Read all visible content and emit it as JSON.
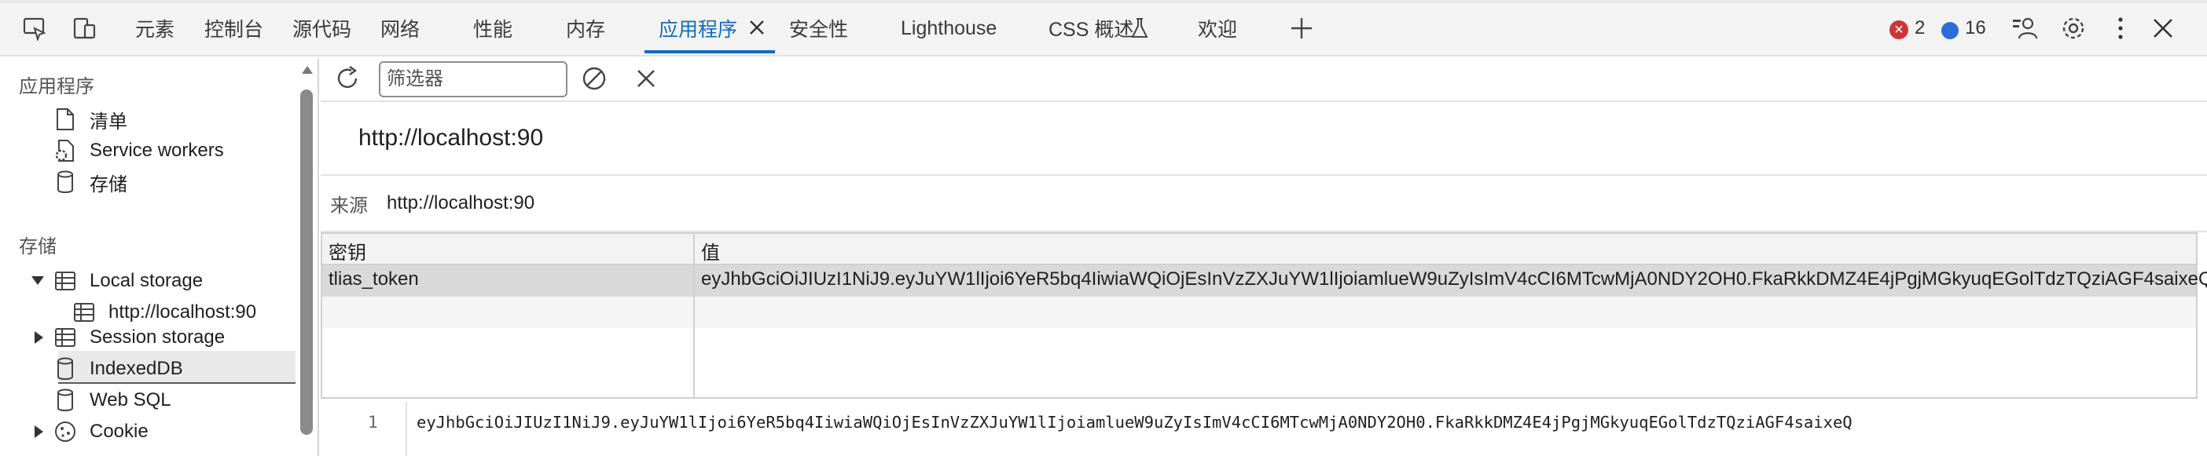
{
  "toolbar": {
    "tabs": [
      {
        "label": "元素"
      },
      {
        "label": "控制台"
      },
      {
        "label": "源代码"
      },
      {
        "label": "网络"
      },
      {
        "label": "性能"
      },
      {
        "label": "内存"
      },
      {
        "label": "应用程序"
      },
      {
        "label": "安全性"
      },
      {
        "label": "Lighthouse"
      },
      {
        "label": "CSS 概述"
      },
      {
        "label": "欢迎"
      }
    ],
    "active_tab": "应用程序",
    "error_count": "2",
    "message_count": "16",
    "accent_color": "#0f6cbd",
    "icons": [
      "inspect-icon",
      "device-toolbar-icon",
      "add-tab-icon",
      "profile-icon",
      "gear-icon",
      "more-icon",
      "close-icon"
    ]
  },
  "sidebar": {
    "section_app": "应用程序",
    "app_items": [
      {
        "label": "清单",
        "icon": "file-icon"
      },
      {
        "label": "Service workers",
        "icon": "service-worker-icon"
      },
      {
        "label": "存储",
        "icon": "database-icon"
      }
    ],
    "section_storage": "存储",
    "storage_items": [
      {
        "label": "Local storage",
        "icon": "table-icon",
        "expanded": true
      },
      {
        "label": "http://localhost:90",
        "icon": "table-icon",
        "selected": true
      },
      {
        "label": "Session storage",
        "icon": "table-icon",
        "expanded": false
      },
      {
        "label": "IndexedDB",
        "icon": "database-icon"
      },
      {
        "label": "Web SQL",
        "icon": "database-icon"
      },
      {
        "label": "Cookie",
        "icon": "cookie-icon",
        "expanded": false
      }
    ]
  },
  "main": {
    "filter_placeholder": "筛选器",
    "origin_title": "http://localhost:90",
    "origin_label": "来源",
    "origin_value": "http://localhost:90",
    "columns": {
      "key": "密钥",
      "value": "值"
    },
    "rows": [
      {
        "key": "tlias_token",
        "value": "eyJhbGciOiJIUzI1NiJ9.eyJuYW1lIjoi6YeR5bq4IiwiaWQiOjEsInVzZXJuYW1lIjoiamlueW9uZyIsImV4cCI6MTcwMjA0NDY2OH0.FkaRkkDMZ4E4jPgjMGkyuqEGolTdzTQziAGF4saixeQ"
      }
    ],
    "preview_line_number": "1",
    "preview_text": "eyJhbGciOiJIUzI1NiJ9.eyJuYW1lIjoi6YeR5bq4IiwiaWQiOjEsInVzZXJuYW1lIjoiamlueW9uZyIsImV4cCI6MTcwMjA0NDY2OH0.FkaRkkDMZ4E4jPgjMGkyuqEGolTdzTQziAGF4saixeQ"
  }
}
